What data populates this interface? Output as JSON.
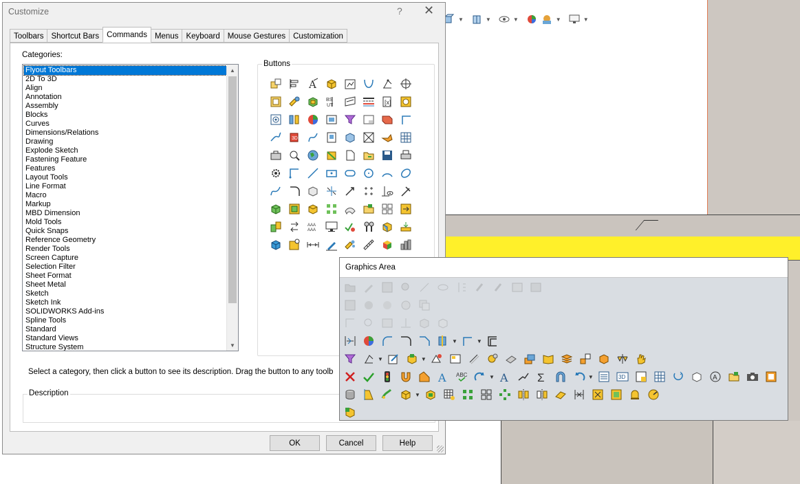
{
  "dialog": {
    "title": "Customize",
    "help_glyph": "?",
    "close_glyph": "✕",
    "tabs": [
      {
        "label": "Toolbars",
        "active": false
      },
      {
        "label": "Shortcut Bars",
        "active": false
      },
      {
        "label": "Commands",
        "active": true
      },
      {
        "label": "Menus",
        "active": false
      },
      {
        "label": "Keyboard",
        "active": false
      },
      {
        "label": "Mouse Gestures",
        "active": false
      },
      {
        "label": "Customization",
        "active": false
      }
    ],
    "categories_label": "Categories:",
    "categories": [
      "Flyout Toolbars",
      "2D To 3D",
      "Align",
      "Annotation",
      "Assembly",
      "Blocks",
      "Curves",
      "Dimensions/Relations",
      "Drawing",
      "Explode Sketch",
      "Fastening Feature",
      "Features",
      "Layout Tools",
      "Line Format",
      "Macro",
      "Markup",
      "MBD Dimension",
      "Mold Tools",
      "Quick Snaps",
      "Reference Geometry",
      "Render Tools",
      "Screen Capture",
      "Selection Filter",
      "Sheet Format",
      "Sheet Metal",
      "Sketch",
      "Sketch Ink",
      "SOLIDWORKS Add-ins",
      "Spline Tools",
      "Standard",
      "Standard Views",
      "Structure System"
    ],
    "selected_category": "Flyout Toolbars",
    "buttons_label": "Buttons",
    "hint_text": "Select a category, then click a button to see its description. Drag the button to any toolb",
    "description_label": "Description",
    "ok_label": "OK",
    "cancel_label": "Cancel",
    "help_label": "Help"
  },
  "graphics_area": {
    "title": "Graphics Area"
  },
  "colors": {
    "selection": "#0078d7",
    "dialog_bg": "#f0f0f0",
    "toolbar_bg": "#d9dde2",
    "beam_yellow": "#fff02a",
    "steel_gray": "#cac4be"
  }
}
